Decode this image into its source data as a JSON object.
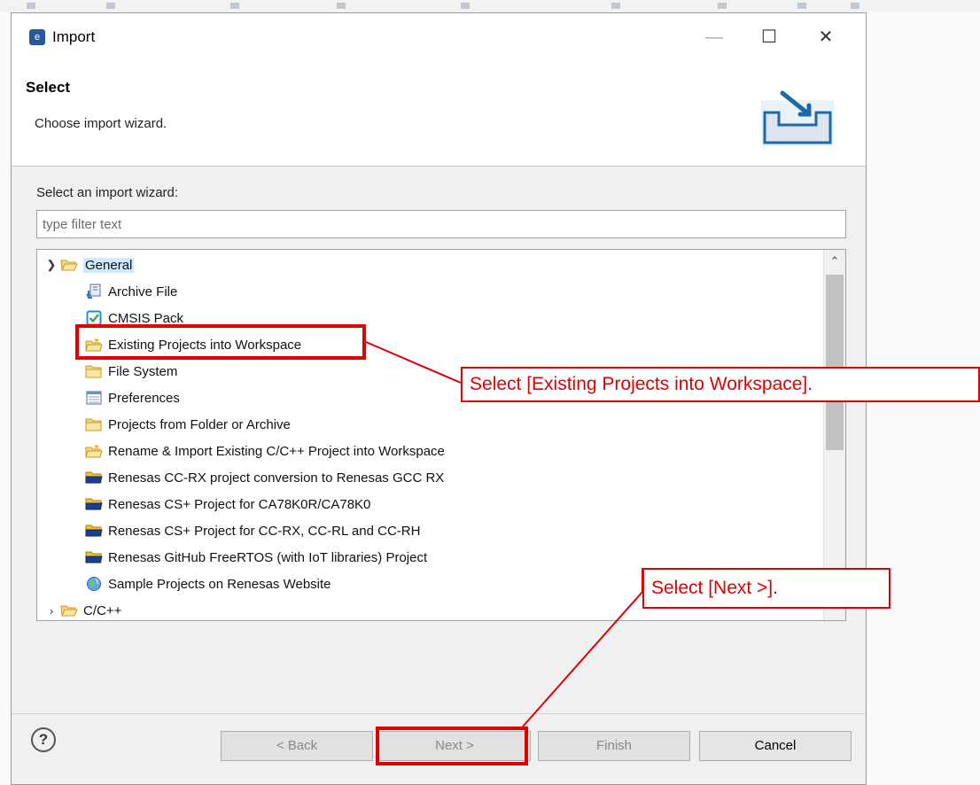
{
  "dialog": {
    "title": "Import",
    "window_controls": {
      "minimize": "—",
      "maximize": "☐",
      "close": "✕"
    }
  },
  "header": {
    "title": "Select",
    "description": "Choose import wizard."
  },
  "wizard": {
    "label": "Select an import wizard:",
    "filter_placeholder": "type filter text"
  },
  "tree": {
    "general": {
      "label": "General",
      "expanded": true
    },
    "items": [
      {
        "label": "Archive File",
        "icon": "archive-file-icon"
      },
      {
        "label": "CMSIS Pack",
        "icon": "cmsis-pack-icon"
      },
      {
        "label": "Existing Projects into Workspace",
        "icon": "existing-projects-icon"
      },
      {
        "label": "File System",
        "icon": "folder-icon"
      },
      {
        "label": "Preferences",
        "icon": "preferences-icon"
      },
      {
        "label": "Projects from Folder or Archive",
        "icon": "folder-icon"
      },
      {
        "label": "Rename & Import Existing C/C++ Project into Workspace",
        "icon": "existing-projects-icon"
      },
      {
        "label": "Renesas CC-RX project conversion to Renesas GCC RX",
        "icon": "renesas-folder-icon"
      },
      {
        "label": "Renesas CS+ Project for CA78K0R/CA78K0",
        "icon": "renesas-folder-icon"
      },
      {
        "label": "Renesas CS+ Project for CC-RX, CC-RL and CC-RH",
        "icon": "renesas-folder-icon"
      },
      {
        "label": "Renesas GitHub FreeRTOS (with IoT libraries) Project",
        "icon": "renesas-folder-icon"
      },
      {
        "label": "Sample Projects on Renesas Website",
        "icon": "globe-icon"
      }
    ],
    "cc": {
      "label": "C/C++",
      "expanded": false
    }
  },
  "buttons": {
    "help": "?",
    "back": "< Back",
    "next": "Next >",
    "finish": "Finish",
    "cancel": "Cancel"
  },
  "annotations": {
    "callout_existing": "Select [Existing Projects into Workspace].",
    "callout_next": "Select [Next >]."
  },
  "colors": {
    "annotation_red": "#e00000",
    "selection_blue": "#cde8ff"
  }
}
